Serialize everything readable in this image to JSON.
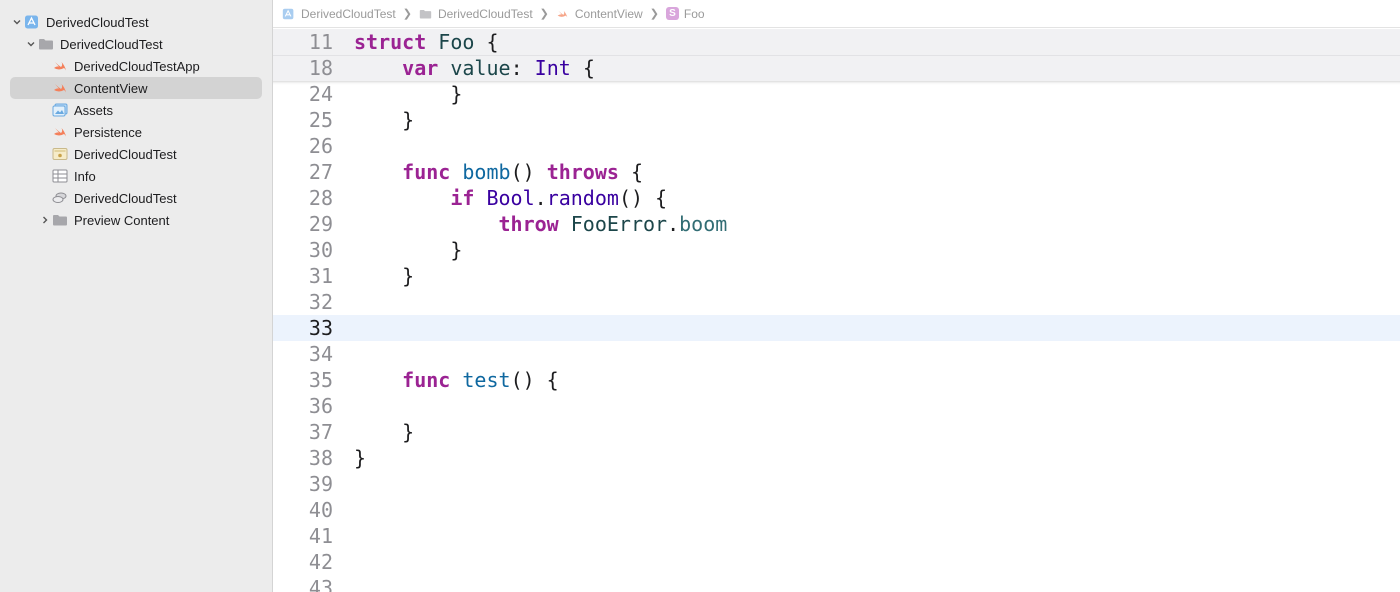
{
  "navigator": {
    "items": [
      {
        "label": "DerivedCloudTest",
        "icon": "xcode-project-icon",
        "disclosure": "expanded"
      },
      {
        "label": "DerivedCloudTest",
        "icon": "folder-icon",
        "disclosure": "expanded"
      },
      {
        "label": "DerivedCloudTestApp",
        "icon": "swift-file-icon"
      },
      {
        "label": "ContentView",
        "icon": "swift-file-icon",
        "selected": true
      },
      {
        "label": "Assets",
        "icon": "asset-catalog-icon"
      },
      {
        "label": "Persistence",
        "icon": "swift-file-icon"
      },
      {
        "label": "DerivedCloudTest",
        "icon": "entitlements-file-icon"
      },
      {
        "label": "Info",
        "icon": "plist-icon"
      },
      {
        "label": "DerivedCloudTest",
        "icon": "core-data-model-icon"
      },
      {
        "label": "Preview Content",
        "icon": "folder-icon",
        "disclosure": "collapsed"
      }
    ]
  },
  "jumpbar": {
    "crumbs": [
      "DerivedCloudTest",
      "DerivedCloudTest",
      "ContentView",
      "Foo"
    ],
    "struct_badge": "S"
  },
  "editor": {
    "lines": [
      {
        "n": "11",
        "text": "struct Foo {"
      },
      {
        "n": "18",
        "text": "    var value: Int {"
      },
      {
        "n": "24",
        "text": "        }"
      },
      {
        "n": "25",
        "text": "    }"
      },
      {
        "n": "26",
        "text": ""
      },
      {
        "n": "27",
        "text": "    func bomb() throws {"
      },
      {
        "n": "28",
        "text": "        if Bool.random() {"
      },
      {
        "n": "29",
        "text": "            throw FooError.boom"
      },
      {
        "n": "30",
        "text": "        }"
      },
      {
        "n": "31",
        "text": "    }"
      },
      {
        "n": "32",
        "text": ""
      },
      {
        "n": "33",
        "text": "",
        "current": true
      },
      {
        "n": "34",
        "text": ""
      },
      {
        "n": "35",
        "text": "    func test() {"
      },
      {
        "n": "36",
        "text": ""
      },
      {
        "n": "37",
        "text": "    }"
      },
      {
        "n": "38",
        "text": "}"
      },
      {
        "n": "39",
        "text": ""
      },
      {
        "n": "40",
        "text": ""
      },
      {
        "n": "41",
        "text": ""
      },
      {
        "n": "42",
        "text": ""
      },
      {
        "n": "43",
        "text": ""
      }
    ]
  },
  "colors": {
    "keyword": "#9b2393",
    "type_decl": "#1c464a",
    "function_name": "#0f68a0",
    "type_ref": "#3900a0",
    "property": "#326d74",
    "current_line": "#ecf3fd",
    "selection": "#d3d3d3"
  }
}
